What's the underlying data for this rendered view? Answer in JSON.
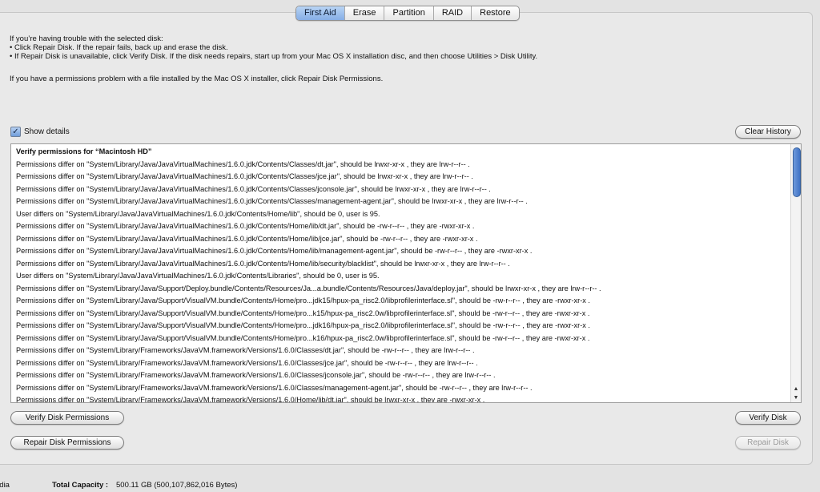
{
  "tabs": [
    {
      "label": "First Aid",
      "active": true
    },
    {
      "label": "Erase",
      "active": false
    },
    {
      "label": "Partition",
      "active": false
    },
    {
      "label": "RAID",
      "active": false
    },
    {
      "label": "Restore",
      "active": false
    }
  ],
  "intro": {
    "line1": "If you’re having trouble with the selected disk:",
    "line2": "• Click Repair Disk. If the repair fails, back up and erase the disk.",
    "line3": "• If Repair Disk is unavailable, click Verify Disk. If the disk needs repairs, start up from your Mac OS X installation disc, and then choose Utilities > Disk Utility.",
    "line4": "If you have a permissions problem with a file installed by the Mac OS X installer, click Repair Disk Permissions."
  },
  "show_details": {
    "label": "Show details",
    "checked": true
  },
  "buttons": {
    "clear_history": "Clear History",
    "verify_permissions": "Verify Disk Permissions",
    "repair_permissions": "Repair Disk Permissions",
    "verify_disk": "Verify Disk",
    "repair_disk": "Repair Disk"
  },
  "log": {
    "header": "Verify permissions for “Macintosh HD”",
    "lines": [
      "Permissions differ on \"System/Library/Java/JavaVirtualMachines/1.6.0.jdk/Contents/Classes/dt.jar\", should be lrwxr-xr-x , they are lrw-r--r-- .",
      "Permissions differ on \"System/Library/Java/JavaVirtualMachines/1.6.0.jdk/Contents/Classes/jce.jar\", should be lrwxr-xr-x , they are lrw-r--r-- .",
      "Permissions differ on \"System/Library/Java/JavaVirtualMachines/1.6.0.jdk/Contents/Classes/jconsole.jar\", should be lrwxr-xr-x , they are lrw-r--r-- .",
      "Permissions differ on \"System/Library/Java/JavaVirtualMachines/1.6.0.jdk/Contents/Classes/management-agent.jar\", should be lrwxr-xr-x , they are lrw-r--r-- .",
      "User differs on \"System/Library/Java/JavaVirtualMachines/1.6.0.jdk/Contents/Home/lib\", should be 0, user is 95.",
      "Permissions differ on \"System/Library/Java/JavaVirtualMachines/1.6.0.jdk/Contents/Home/lib/dt.jar\", should be -rw-r--r-- , they are -rwxr-xr-x .",
      "Permissions differ on \"System/Library/Java/JavaVirtualMachines/1.6.0.jdk/Contents/Home/lib/jce.jar\", should be -rw-r--r-- , they are -rwxr-xr-x .",
      "Permissions differ on \"System/Library/Java/JavaVirtualMachines/1.6.0.jdk/Contents/Home/lib/management-agent.jar\", should be -rw-r--r-- , they are -rwxr-xr-x .",
      "Permissions differ on \"System/Library/Java/JavaVirtualMachines/1.6.0.jdk/Contents/Home/lib/security/blacklist\", should be lrwxr-xr-x , they are lrw-r--r-- .",
      "User differs on \"System/Library/Java/JavaVirtualMachines/1.6.0.jdk/Contents/Libraries\", should be 0, user is 95.",
      "Permissions differ on \"System/Library/Java/Support/Deploy.bundle/Contents/Resources/Ja...a.bundle/Contents/Resources/Java/deploy.jar\", should be lrwxr-xr-x , they are lrw-r--r-- .",
      "Permissions differ on \"System/Library/Java/Support/VisualVM.bundle/Contents/Home/pro...jdk15/hpux-pa_risc2.0/libprofilerinterface.sl\", should be -rw-r--r-- , they are -rwxr-xr-x .",
      "Permissions differ on \"System/Library/Java/Support/VisualVM.bundle/Contents/Home/pro...k15/hpux-pa_risc2.0w/libprofilerinterface.sl\", should be -rw-r--r-- , they are -rwxr-xr-x .",
      "Permissions differ on \"System/Library/Java/Support/VisualVM.bundle/Contents/Home/pro...jdk16/hpux-pa_risc2.0/libprofilerinterface.sl\", should be -rw-r--r-- , they are -rwxr-xr-x .",
      "Permissions differ on \"System/Library/Java/Support/VisualVM.bundle/Contents/Home/pro...k16/hpux-pa_risc2.0w/libprofilerinterface.sl\", should be -rw-r--r-- , they are -rwxr-xr-x .",
      "Permissions differ on \"System/Library/Frameworks/JavaVM.framework/Versions/1.6.0/Classes/dt.jar\", should be -rw-r--r-- , they are lrw-r--r-- .",
      "Permissions differ on \"System/Library/Frameworks/JavaVM.framework/Versions/1.6.0/Classes/jce.jar\", should be -rw-r--r-- , they are lrw-r--r-- .",
      "Permissions differ on \"System/Library/Frameworks/JavaVM.framework/Versions/1.6.0/Classes/jconsole.jar\", should be -rw-r--r-- , they are lrw-r--r-- .",
      "Permissions differ on \"System/Library/Frameworks/JavaVM.framework/Versions/1.6.0/Classes/management-agent.jar\", should be -rw-r--r-- , they are lrw-r--r-- .",
      "Permissions differ on \"System/Library/Frameworks/JavaVM.framework/Versions/1.6.0/Home/lib/dt.jar\", should be lrwxr-xr-x , they are -rwxr-xr-x ."
    ]
  },
  "footer": {
    "media_label": "edia",
    "capacity_label": "Total Capacity :",
    "capacity_value": "500.11 GB (500,107,862,016 Bytes)"
  },
  "icons": {
    "checkbox": "checkmark-icon",
    "scroll_up": "arrow-up-icon",
    "scroll_down": "arrow-down-icon"
  },
  "colors": {
    "accent": "#86aee6",
    "scroll_thumb": "#3f72c5",
    "disabled_text": "#9a9a9a"
  }
}
